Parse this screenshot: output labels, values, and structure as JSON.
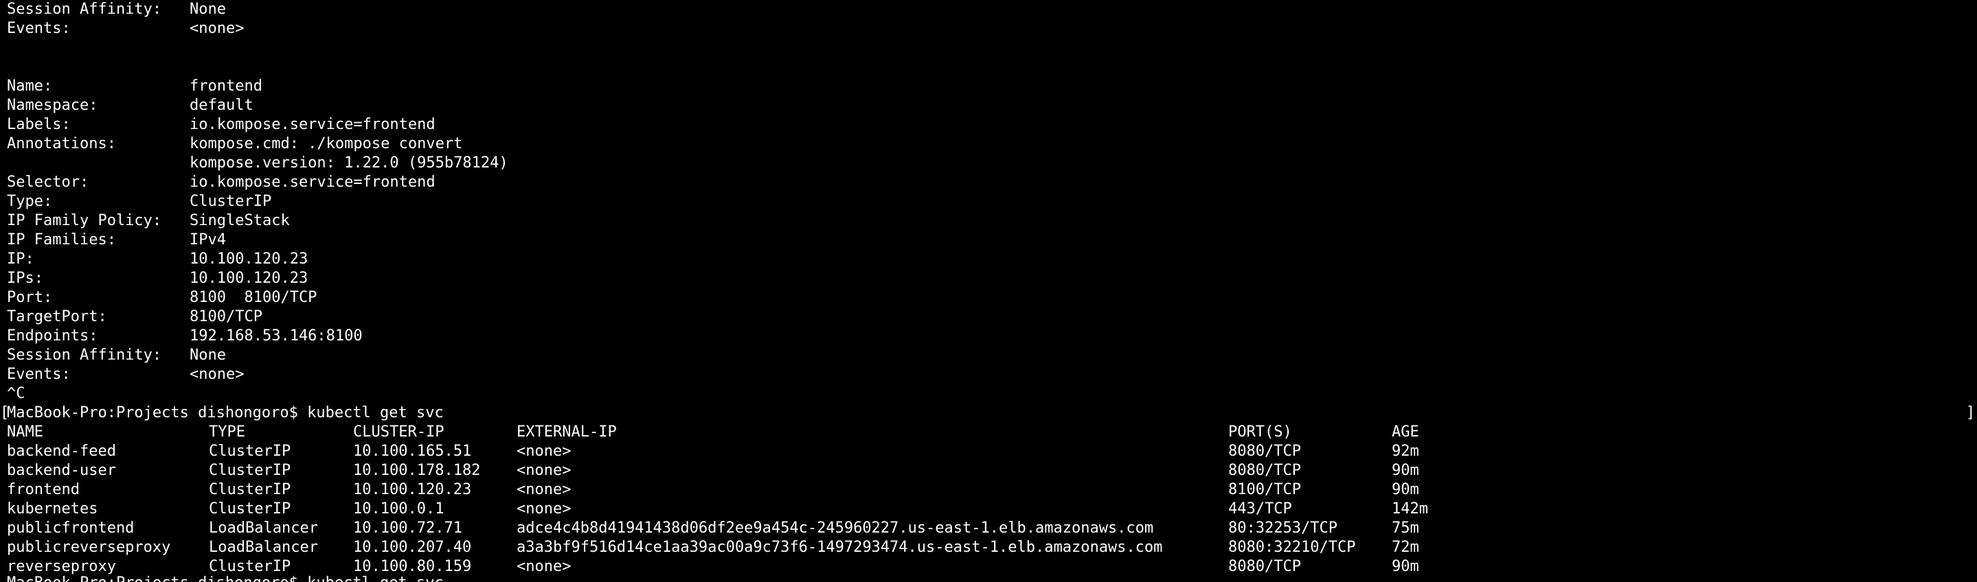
{
  "terminal": {
    "text_color": "#ffffff",
    "background": "#000000"
  },
  "top_block": {
    "session_affinity_key": "Session Affinity:",
    "session_affinity_value": "None",
    "events_key": "Events:",
    "events_value": "<none>"
  },
  "service_describe": {
    "fields": [
      {
        "key": "Name:",
        "value": "frontend"
      },
      {
        "key": "Namespace:",
        "value": "default"
      },
      {
        "key": "Labels:",
        "value": "io.kompose.service=frontend"
      },
      {
        "key": "Annotations:",
        "value": "kompose.cmd: ./kompose convert"
      },
      {
        "key": "",
        "value": "kompose.version: 1.22.0 (955b78124)"
      },
      {
        "key": "Selector:",
        "value": "io.kompose.service=frontend"
      },
      {
        "key": "Type:",
        "value": "ClusterIP"
      },
      {
        "key": "IP Family Policy:",
        "value": "SingleStack"
      },
      {
        "key": "IP Families:",
        "value": "IPv4"
      },
      {
        "key": "IP:",
        "value": "10.100.120.23"
      },
      {
        "key": "IPs:",
        "value": "10.100.120.23"
      },
      {
        "key": "Port:",
        "value": "8100  8100/TCP"
      },
      {
        "key": "TargetPort:",
        "value": "8100/TCP"
      },
      {
        "key": "Endpoints:",
        "value": "192.168.53.146:8100"
      },
      {
        "key": "Session Affinity:",
        "value": "None"
      },
      {
        "key": "Events:",
        "value": "<none>"
      }
    ]
  },
  "interrupt": "^C",
  "prompt": {
    "bracket_open": "[",
    "text": "MacBook-Pro:Projects dishongoro$ kubectl get svc",
    "bracket_close": "]"
  },
  "svc_table": {
    "headers": [
      "NAME",
      "TYPE",
      "CLUSTER-IP",
      "EXTERNAL-IP",
      "PORT(S)",
      "AGE"
    ],
    "rows": [
      [
        "backend-feed",
        "ClusterIP",
        "10.100.165.51",
        "<none>",
        "8080/TCP",
        "92m"
      ],
      [
        "backend-user",
        "ClusterIP",
        "10.100.178.182",
        "<none>",
        "8080/TCP",
        "90m"
      ],
      [
        "frontend",
        "ClusterIP",
        "10.100.120.23",
        "<none>",
        "8100/TCP",
        "90m"
      ],
      [
        "kubernetes",
        "ClusterIP",
        "10.100.0.1",
        "<none>",
        "443/TCP",
        "142m"
      ],
      [
        "publicfrontend",
        "LoadBalancer",
        "10.100.72.71",
        "adce4c4b8d41941438d06df2ee9a454c-245960227.us-east-1.elb.amazonaws.com",
        "80:32253/TCP",
        "75m"
      ],
      [
        "publicreverseproxy",
        "LoadBalancer",
        "10.100.207.40",
        "a3a3bf9f516d14ce1aa39ac00a9c73f6-1497293474.us-east-1.elb.amazonaws.com",
        "8080:32210/TCP",
        "72m"
      ],
      [
        "reverseproxy",
        "ClusterIP",
        "10.100.80.159",
        "<none>",
        "8080/TCP",
        "90m"
      ]
    ]
  },
  "partial_next_prompt": "MacBook-Pro:Projects dishongoro$ kubectl get svc"
}
